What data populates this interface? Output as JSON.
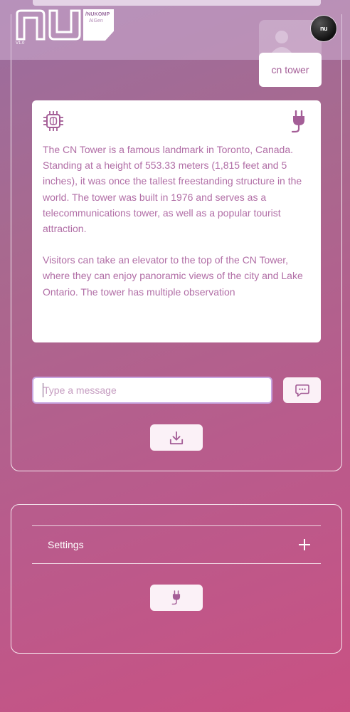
{
  "header": {
    "logo_icon": "nu-logo-icon",
    "version": "V1.0",
    "brand_title": "/NUKOMP",
    "brand_sub": "AIGen",
    "avatar_text": "nu"
  },
  "chat": {
    "user_message": "cn tower",
    "bot_icon": "chip-icon",
    "plugin_icon": "plug-icon",
    "bot_paragraphs": [
      "The CN Tower is a famous landmark in Toronto, Canada. Standing at a height of 553.33 meters (1,815 feet and 5 inches), it was once the tallest freestanding structure in the world. The tower was built in 1976 and serves as a telecommunications tower, as well as a popular tourist attraction.",
      "Visitors can take an elevator to the top of the CN Tower, where they can enjoy panoramic views of the city and Lake Ontario. The tower has multiple observation"
    ]
  },
  "composer": {
    "placeholder": "Type a message",
    "send_icon": "message-icon",
    "download_icon": "download-icon"
  },
  "settings": {
    "label": "Settings",
    "expand_icon": "plus-icon",
    "plugin_icon": "plug-icon"
  },
  "colors": {
    "accent_text": "#b16ea6",
    "input_border": "#c7a6e2"
  }
}
